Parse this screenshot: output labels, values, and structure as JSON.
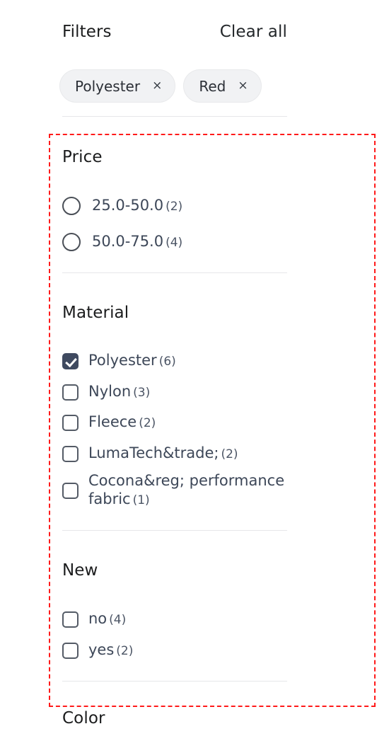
{
  "header": {
    "title": "Filters",
    "clear_all_label": "Clear all"
  },
  "active_filters": [
    {
      "label": "Polyester",
      "remove_icon": "close-icon",
      "remove_glyph": "×"
    },
    {
      "label": "Red",
      "remove_icon": "close-icon",
      "remove_glyph": "×"
    }
  ],
  "groups": [
    {
      "name": "price",
      "heading": "Price",
      "control": "radio",
      "options": [
        {
          "label": "25.0-50.0",
          "count": "(2)",
          "selected": false
        },
        {
          "label": "50.0-75.0",
          "count": "(4)",
          "selected": false
        }
      ]
    },
    {
      "name": "material",
      "heading": "Material",
      "control": "checkbox",
      "options": [
        {
          "label": "Polyester",
          "count": "(6)",
          "selected": true
        },
        {
          "label": "Nylon",
          "count": "(3)",
          "selected": false
        },
        {
          "label": "Fleece",
          "count": "(2)",
          "selected": false
        },
        {
          "label": "LumaTech&trade;",
          "count": "(2)",
          "selected": false
        },
        {
          "label": "Cocona&reg; performance fabric",
          "count": "(1)",
          "selected": false
        }
      ]
    },
    {
      "name": "new",
      "heading": "New",
      "control": "checkbox",
      "options": [
        {
          "label": "no",
          "count": "(4)",
          "selected": false
        },
        {
          "label": "yes",
          "count": "(2)",
          "selected": false
        }
      ]
    },
    {
      "name": "color",
      "heading": "Color",
      "control": "swatch",
      "options": []
    }
  ],
  "annotation": {
    "type": "highlight-box",
    "style": "red-dashed",
    "color": "#ff1a1a"
  },
  "colors": {
    "heading_text": "#1b1c1d",
    "option_text": "#3d4758",
    "count_text": "#4c5565",
    "pill_background": "#f1f2f4",
    "pill_border": "#e8e9eb",
    "checkbox_checked": "#3f4a60",
    "divider": "#e6e7e9",
    "annotation": "#ff1a1a",
    "page_background": "#ffffff"
  }
}
